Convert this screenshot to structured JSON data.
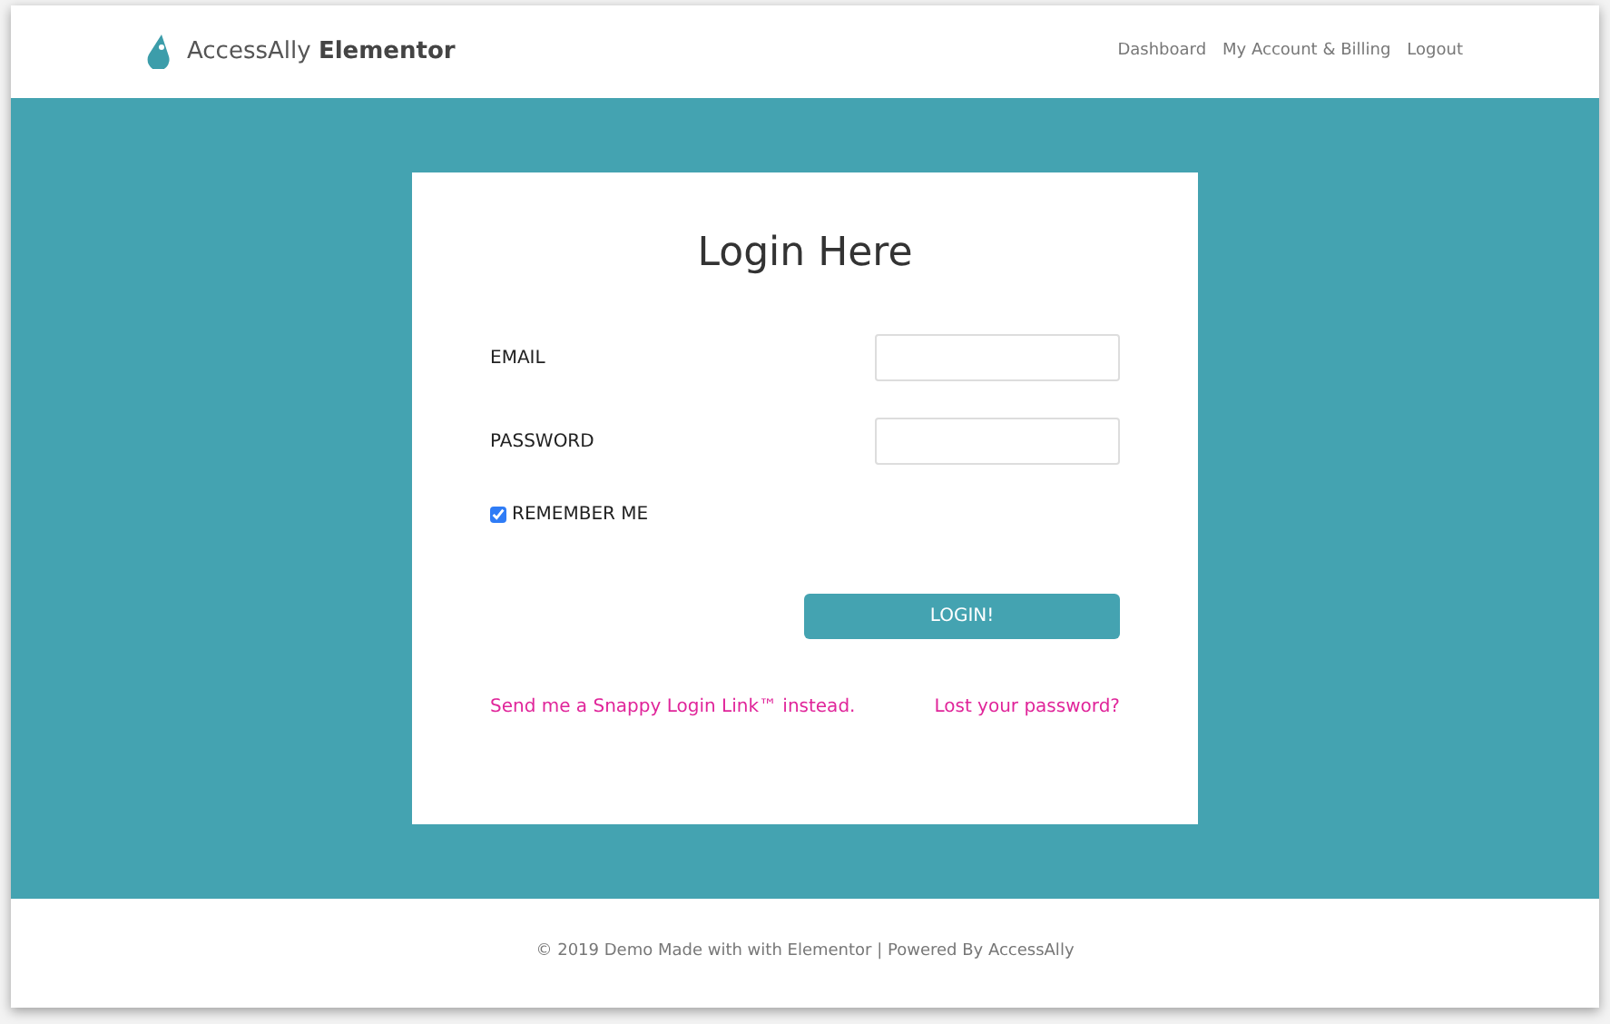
{
  "header": {
    "brand": {
      "name": "AccessAlly",
      "suffix": "Elementor"
    },
    "nav": [
      {
        "label": "Dashboard"
      },
      {
        "label": "My Account & Billing"
      },
      {
        "label": "Logout"
      }
    ]
  },
  "login": {
    "title": "Login Here",
    "fields": [
      {
        "label": "EMAIL"
      },
      {
        "label": "PASSWORD"
      }
    ],
    "remember": {
      "label": "REMEMBER ME",
      "checked": true
    },
    "button": "LOGIN!",
    "links": [
      {
        "label": "Send me a Snappy Login Link™ instead."
      },
      {
        "label": "Lost your password?"
      }
    ]
  },
  "footer": {
    "text": "© 2019 Demo Made with with Elementor | Powered By AccessAlly"
  }
}
